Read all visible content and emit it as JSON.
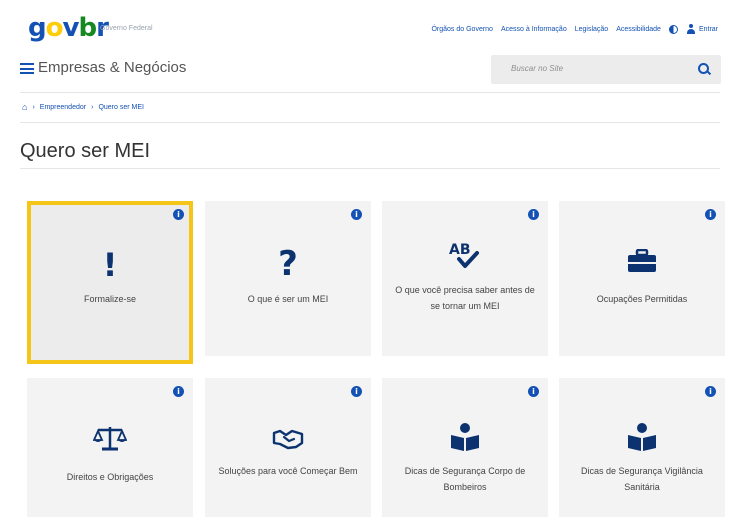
{
  "header": {
    "logo": "gov.br",
    "subtitle": "Governo Federal",
    "links": [
      "Órgãos do Governo",
      "Acesso à Informação",
      "Legislação",
      "Acessibilidade"
    ],
    "login_label": "Entrar"
  },
  "menu": {
    "site_title": "Empresas & Negócios",
    "search_placeholder": "Buscar no Site"
  },
  "breadcrumb": [
    "Empreendedor",
    "Quero ser MEI"
  ],
  "page_title": "Quero ser MEI",
  "cards": [
    {
      "label": "Formalize-se",
      "icon": "exclamation-icon",
      "selected": true
    },
    {
      "label": "O que é ser um MEI",
      "icon": "question-icon"
    },
    {
      "label": "O que você precisa saber antes de se tornar um MEI",
      "icon": "spellcheck-icon"
    },
    {
      "label": "Ocupações Permitidas",
      "icon": "briefcase-icon"
    },
    {
      "label": "Direitos e Obrigações",
      "icon": "balance-scale-icon"
    },
    {
      "label": "Soluções para você Começar Bem",
      "icon": "handshake-icon"
    },
    {
      "label": "Dicas de Segurança Corpo de Bombeiros",
      "icon": "book-reader-icon"
    },
    {
      "label": "Dicas de Segurança Vigilância Sanitária",
      "icon": "book-reader-icon"
    }
  ],
  "colors": {
    "primary": "#1351b4",
    "dark_icon": "#0c326f",
    "highlight": "#f5c518"
  }
}
